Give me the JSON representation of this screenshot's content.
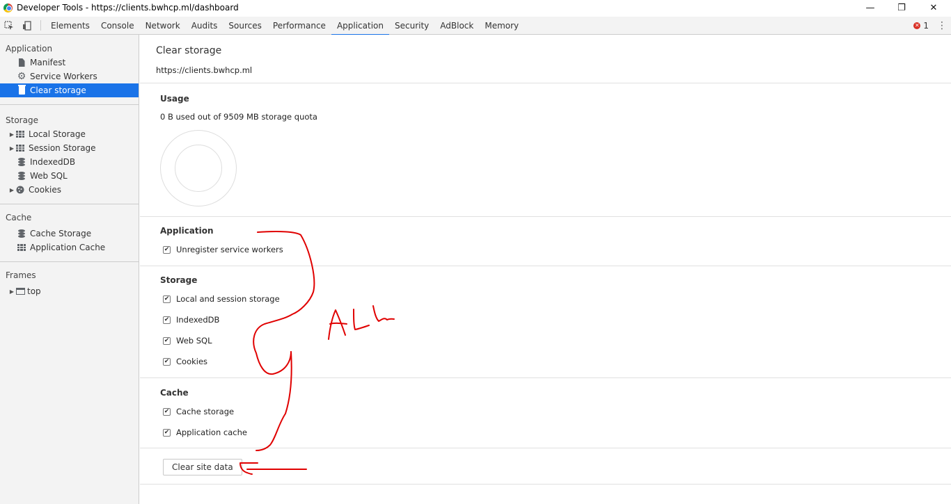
{
  "window": {
    "title": "Developer Tools - https://clients.bwhcp.ml/dashboard",
    "controls": {
      "minimize": "—",
      "restore": "❐",
      "close": "✕"
    }
  },
  "toolbar": {
    "tabs": [
      "Elements",
      "Console",
      "Network",
      "Audits",
      "Sources",
      "Performance",
      "Application",
      "Security",
      "AdBlock",
      "Memory"
    ],
    "active_tab": "Application",
    "error_count": "1",
    "colors": {
      "accent": "#1a73e8",
      "error": "#d93025"
    }
  },
  "sidebar": {
    "application_header": "Application",
    "application_items": [
      "Manifest",
      "Service Workers",
      "Clear storage"
    ],
    "storage_header": "Storage",
    "storage_items": [
      "Local Storage",
      "Session Storage",
      "IndexedDB",
      "Web SQL",
      "Cookies"
    ],
    "cache_header": "Cache",
    "cache_items": [
      "Cache Storage",
      "Application Cache"
    ],
    "frames_header": "Frames",
    "frames_items": [
      "top"
    ]
  },
  "main": {
    "title": "Clear storage",
    "origin": "https://clients.bwhcp.ml",
    "usage": {
      "title": "Usage",
      "text": "0 B used out of 9509 MB storage quota"
    },
    "application": {
      "title": "Application",
      "options": [
        "Unregister service workers"
      ]
    },
    "storage": {
      "title": "Storage",
      "options": [
        "Local and session storage",
        "IndexedDB",
        "Web SQL",
        "Cookies"
      ]
    },
    "cache": {
      "title": "Cache",
      "options": [
        "Cache storage",
        "Application cache"
      ]
    },
    "checked_mark": "✔",
    "clear_button": "Clear site data"
  },
  "annotation": {
    "handwritten_text": "ALL",
    "ink_color": "#e00000"
  }
}
